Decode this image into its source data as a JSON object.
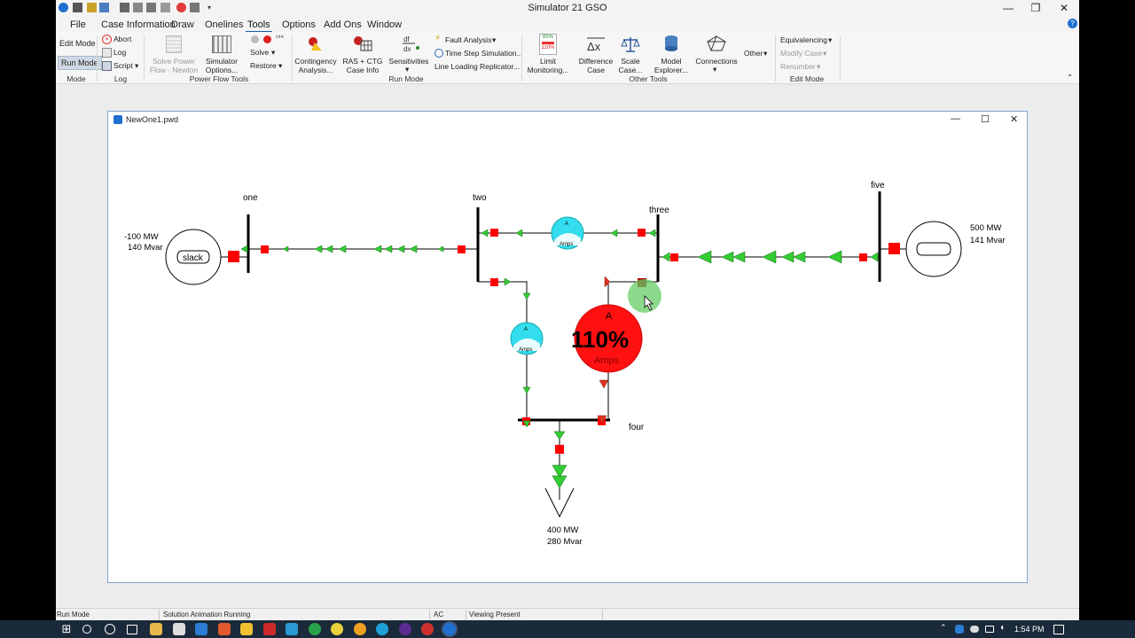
{
  "app": {
    "title": "Simulator 21 GSO"
  },
  "window_controls": {
    "minimize": "—",
    "maximize": "❐",
    "close": "✕"
  },
  "menu": {
    "tabs": [
      {
        "label": "File"
      },
      {
        "label": "Case Information"
      },
      {
        "label": "Draw"
      },
      {
        "label": "Onelines"
      },
      {
        "label": "Tools"
      },
      {
        "label": "Options"
      },
      {
        "label": "Add Ons"
      },
      {
        "label": "Window"
      }
    ],
    "active_tab": "Tools",
    "help": "?"
  },
  "ribbon": {
    "mode": {
      "edit_mode": "Edit Mode",
      "run_mode": "Run Mode",
      "group": "Mode"
    },
    "log": {
      "abort": "Abort",
      "log": "Log",
      "script": "Script",
      "group": "Log"
    },
    "power_flow_tools": {
      "solve_power_flow": [
        "Solve Power",
        "Flow - Newton"
      ],
      "simulator_options": [
        "Simulator",
        "Options..."
      ],
      "solve": "Solve",
      "restore": "Restore",
      "group": "Power Flow Tools"
    },
    "run_mode": {
      "contingency": [
        "Contingency",
        "Analysis..."
      ],
      "ras_ctg": [
        "RAS + CTG",
        "Case Info"
      ],
      "sensitivities": "Sensitivities",
      "fault_analysis": "Fault Analysis",
      "time_step": "Time Step Simulation...",
      "line_loading": "Line Loading Replicator...",
      "group": "Run Mode"
    },
    "other_tools": {
      "limit_monitoring": [
        "Limit",
        "Monitoring..."
      ],
      "limit_icon_text": [
        "85%",
        "110%"
      ],
      "difference_case": [
        "Difference",
        "Case"
      ],
      "scale_case": [
        "Scale",
        "Case..."
      ],
      "model_explorer": [
        "Model",
        "Explorer..."
      ],
      "connections": "Connections",
      "other": "Other",
      "group": "Other Tools"
    },
    "edit_mode": {
      "equivalencing": "Equivalencing",
      "modify_case": "Modify Case",
      "renumber": "Renumber",
      "group": "Edit Mode"
    }
  },
  "oneline": {
    "window_title": "NewOne1.pwd",
    "buses": {
      "one": "one",
      "two": "two",
      "three": "three",
      "four": "four",
      "five": "five"
    },
    "slack_gen": {
      "label": "slack",
      "mw": "-100 MW",
      "mvar": "140 Mvar"
    },
    "gen_five": {
      "mw": "500 MW",
      "mvar": "141 Mvar"
    },
    "load_four": {
      "mw": "400 MW",
      "mvar": "280 Mvar"
    },
    "gauge_small": {
      "letter": "A",
      "unit": "Amps"
    },
    "gauge_overload": {
      "letter": "A",
      "value": "110%",
      "unit": "Amps",
      "loading_percent": 110
    },
    "colors": {
      "flow_arrow": "#22cc22",
      "breaker": "#ff0000",
      "gauge_ok": "#33ddee",
      "gauge_overload": "#ff1111",
      "cursor_highlight": "#66cc66"
    }
  },
  "status": {
    "mode": "Run Mode",
    "animation": "Solution Animation Running",
    "solution": "AC",
    "viewing": "Viewing Present"
  },
  "taskbar": {
    "time": "1:54 PM"
  }
}
